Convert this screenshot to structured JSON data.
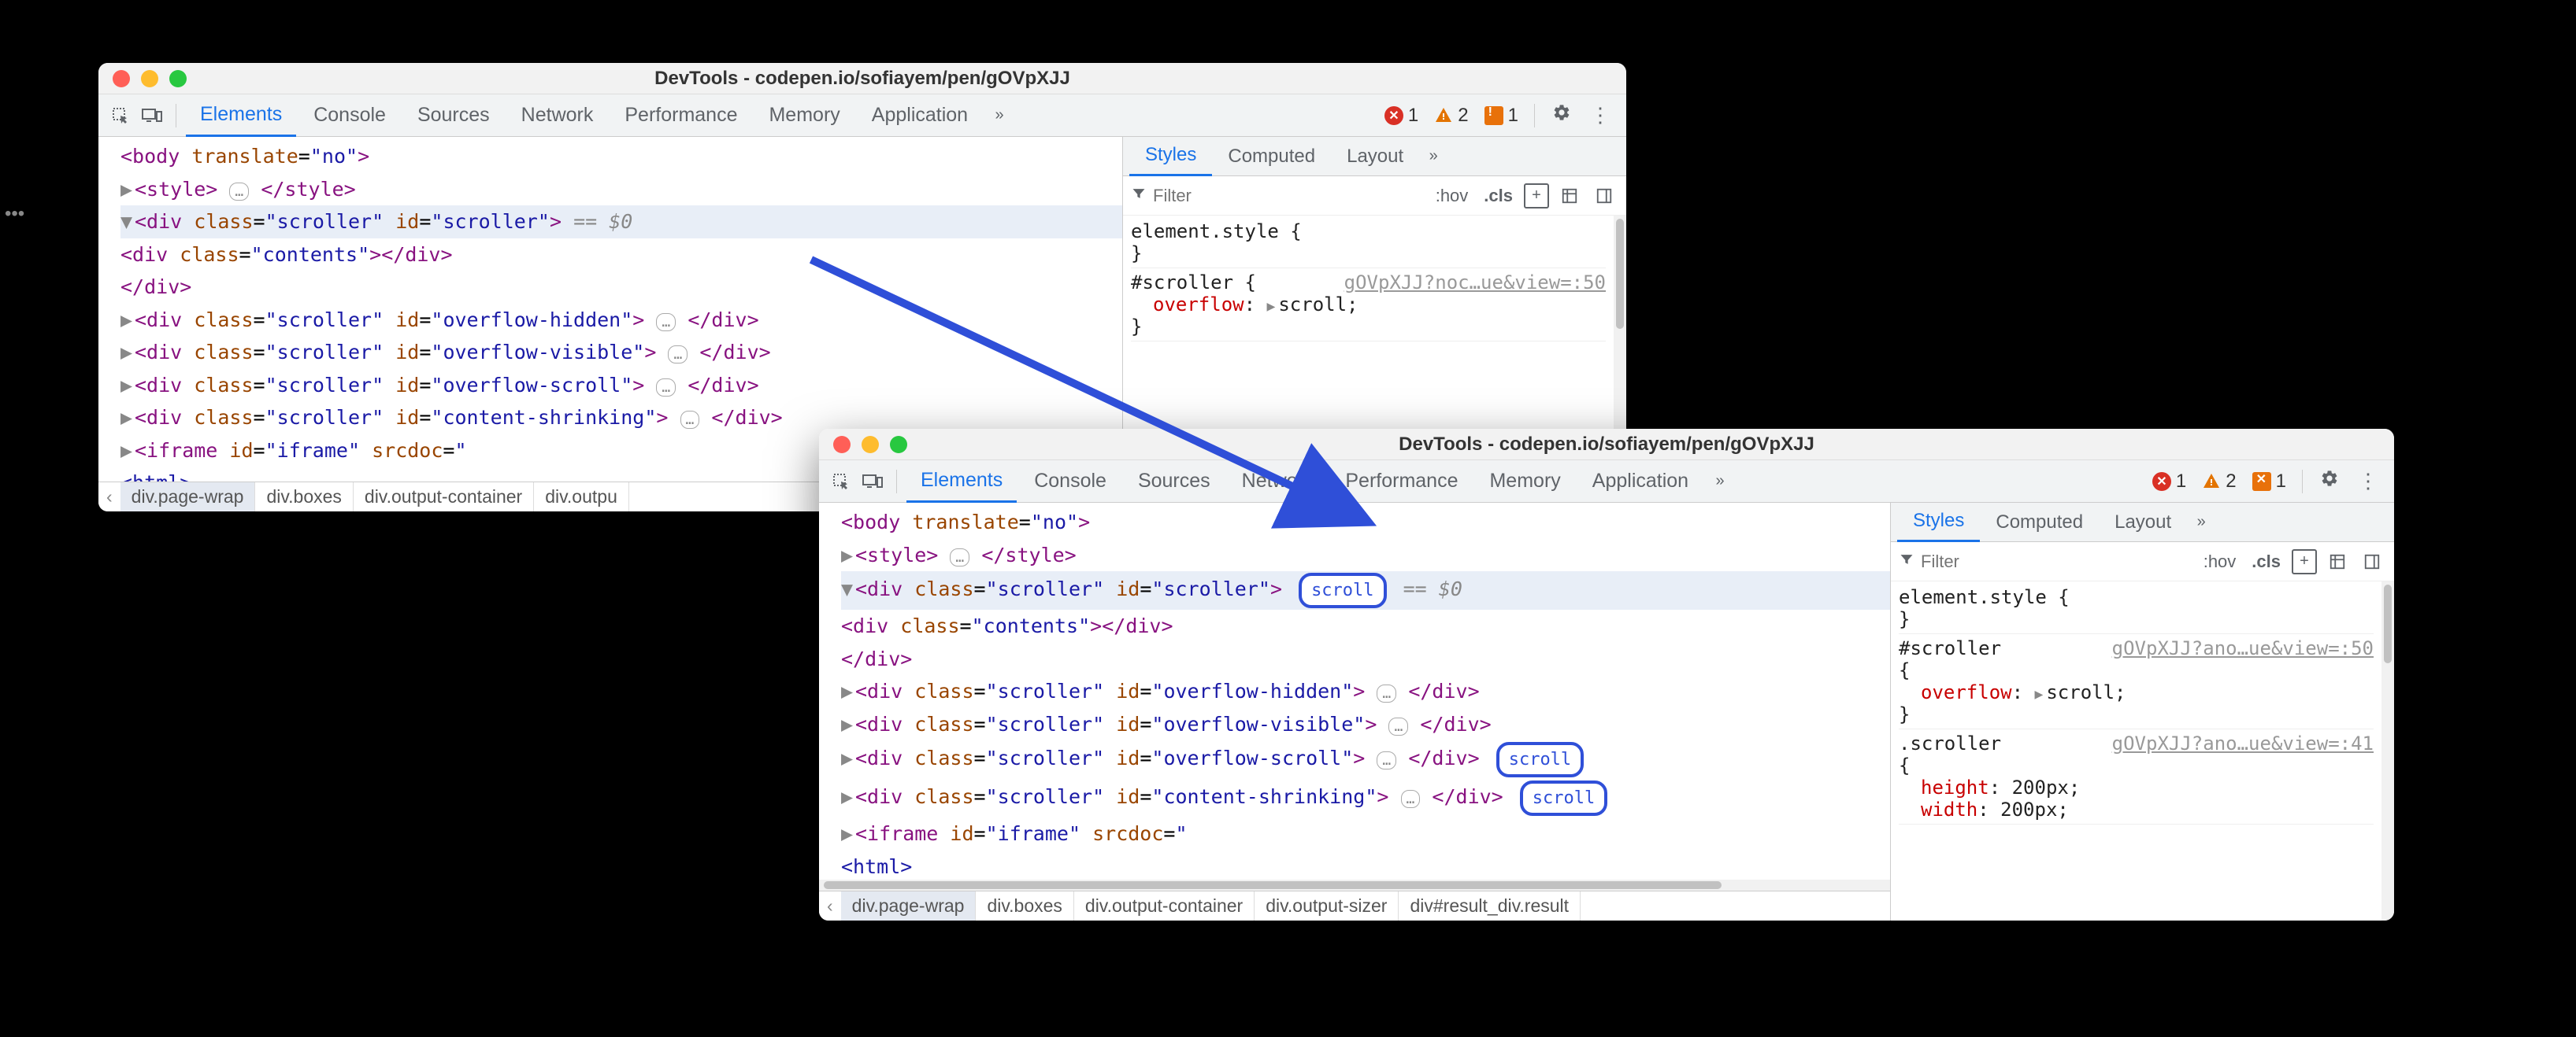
{
  "window_title": "DevTools - codepen.io/sofiayem/pen/gOVpXJJ",
  "tabs": {
    "elements": "Elements",
    "console": "Console",
    "sources": "Sources",
    "network": "Network",
    "performance": "Performance",
    "memory": "Memory",
    "application": "Application"
  },
  "issues": {
    "errors": "1",
    "warnings": "2",
    "flags": "1"
  },
  "sidebar_tabs": {
    "styles": "Styles",
    "computed": "Computed",
    "layout": "Layout"
  },
  "filter_placeholder": "Filter",
  "pseudo": {
    "hov": ":hov",
    "cls": ".cls"
  },
  "dom": {
    "body_frag": "translate=\"no\"",
    "style_open": "<style>",
    "style_close": "</style>",
    "div_open": "<div",
    "div_close": "</div>",
    "close_div_short": "</div>",
    "class_attr": "class",
    "id_attr": "id",
    "scroller": "scroller",
    "scroller_id": "scroller",
    "contents": "contents",
    "ov_hidden": "overflow-hidden",
    "ov_visible": "overflow-visible",
    "ov_scroll": "overflow-scroll",
    "content_shrinking": "content-shrinking",
    "iframe_open": "<iframe",
    "iframe_id": "iframe",
    "srcdoc": "srcdoc",
    "html": "<html>",
    "style_tag": "<style>",
    "eq": "== $0",
    "gt": ">",
    "eq_sign": "=",
    "q": "\"",
    "ellipsis": "…",
    "scroll_badge": "scroll",
    "body_open": "<body"
  },
  "crumbs1": [
    "div.page-wrap",
    "div.boxes",
    "div.output-container",
    "div.outpu"
  ],
  "crumbs2": [
    "div.page-wrap",
    "div.boxes",
    "div.output-container",
    "div.output-sizer",
    "div#result_div.result"
  ],
  "styles1": {
    "element_style": "element.style {",
    "close": "}",
    "scroller_sel": "#scroller {",
    "overflow": "overflow",
    "scroll_val": "scroll",
    "src1": "gOVpXJJ?noc…ue&view=:50"
  },
  "styles2": {
    "element_style": "element.style {",
    "close": "}",
    "scroller_sel": "#scroller",
    "brace": "{",
    "overflow": "overflow",
    "scroll_val": "scroll",
    "src1": "gOVpXJJ?ano…ue&view=:50",
    "scroller_class": ".scroller",
    "src2": "gOVpXJJ?ano…ue&view=:41",
    "height": "height",
    "width": "width",
    "px200": "200px"
  },
  "colon": ":",
  "semi": ";"
}
